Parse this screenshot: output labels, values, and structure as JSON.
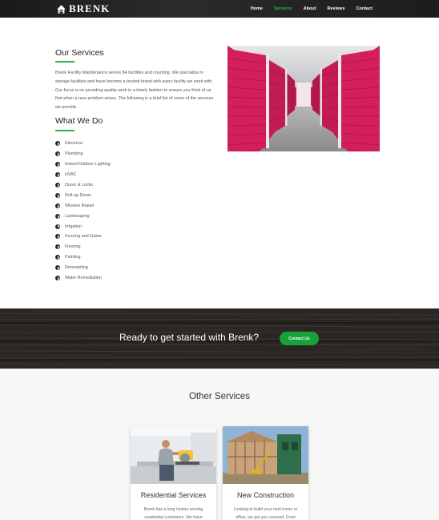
{
  "header": {
    "logo_text": "BRENK",
    "nav": [
      "Home",
      "Services",
      "About",
      "Reviews",
      "Contact"
    ],
    "active_nav": "Services"
  },
  "our_services": {
    "title": "Our Services",
    "intro": "Brenk Facility Maintenance serves 84 facilities and counting. We specialize in storage facilities and have become a trusted brand with every facility we work with. Our focus is on providing quality work in a timely fashion to ensure you think of us first when a new problem arises. The following is a brief list of some of the services we provide."
  },
  "what_we_do": {
    "title": "What We Do",
    "items": [
      "Electrical",
      "Plumbing",
      "Indoor/Outdoor Lighting",
      "HVAC",
      "Doors & Locks",
      "Roll-up Doors",
      "Window Repair",
      "Landscaping",
      "Irrigation",
      "Fencing and Gates",
      "Flooring",
      "Painting",
      "Remodeling",
      "Water Remediation"
    ]
  },
  "cta": {
    "text": "Ready to get started with Brenk?",
    "button": "Contact Us"
  },
  "other_services": {
    "title": "Other Services",
    "cards": [
      {
        "title": "Residential Services",
        "desc": "Brenk has a long history serving residential customers. We have"
      },
      {
        "title": "New Construction",
        "desc": "Looking to build your next home or office, we got you covered. From"
      }
    ]
  },
  "colors": {
    "accent": "#2db34a",
    "header_bg": "#1f1f1f",
    "cta_button": "#18a33a"
  }
}
